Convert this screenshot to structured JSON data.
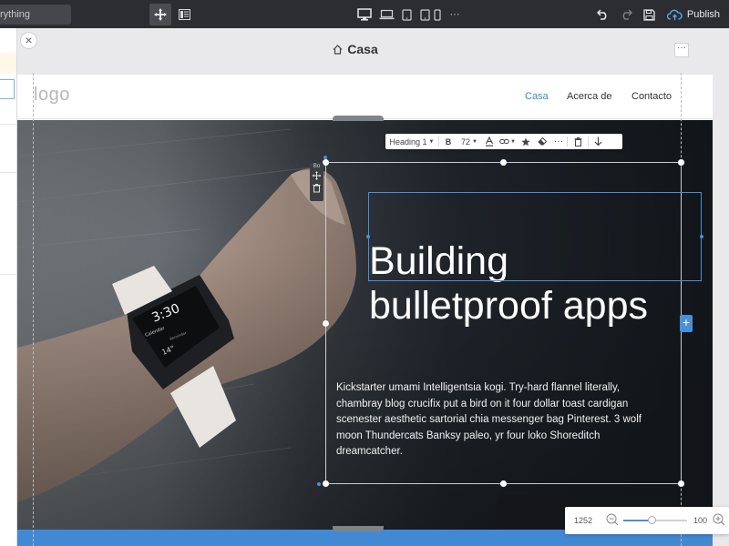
{
  "toolbar": {
    "search_text": "rything",
    "devices": [
      "desktop-icon",
      "laptop-icon",
      "tablet-icon",
      "mobile-icon"
    ],
    "more_label": "···",
    "publish_label": "Publish"
  },
  "canvas": {
    "page_title": "Casa",
    "close_label": "×",
    "more_label": "···"
  },
  "site": {
    "logo": "logo",
    "nav": [
      {
        "label": "Casa",
        "active": true
      },
      {
        "label": "Acerca de",
        "active": false
      },
      {
        "label": "Contacto",
        "active": false
      }
    ],
    "hero_title": "Building bulletproof apps",
    "hero_text": "Kickstarter umami Intelligentsia kogi. Try-hard flannel literally, chambray blog crucifix put a bird on it four dollar toast cardigan scenester aesthetic sartorial chia messenger bag Pinterest. 3 wolf moon Thundercats Banksy paleo, yr four loko Shoreditch dreamcatcher."
  },
  "watch": {
    "time": "3:30",
    "line1": "Calendar",
    "line2": "14°",
    "line3": "Reminder"
  },
  "format_bar": {
    "style_label": "Heading 1",
    "bold_label": "B",
    "size_label": "72",
    "icons": [
      "text-color-icon",
      "link-icon",
      "star-icon",
      "eraser-icon",
      "more-icon",
      "trash-icon",
      "move-down-icon"
    ]
  },
  "side_tools": {
    "label": "Bo"
  },
  "zoom": {
    "canvas_width": "1252",
    "zoom_value": "100",
    "slider_fraction": 0.45
  },
  "colors": {
    "toolbar_bg": "#2b2d31",
    "accent": "#4a8fd8",
    "nav_active": "#3a8bbf",
    "hero_bottom": "#4289d4"
  }
}
